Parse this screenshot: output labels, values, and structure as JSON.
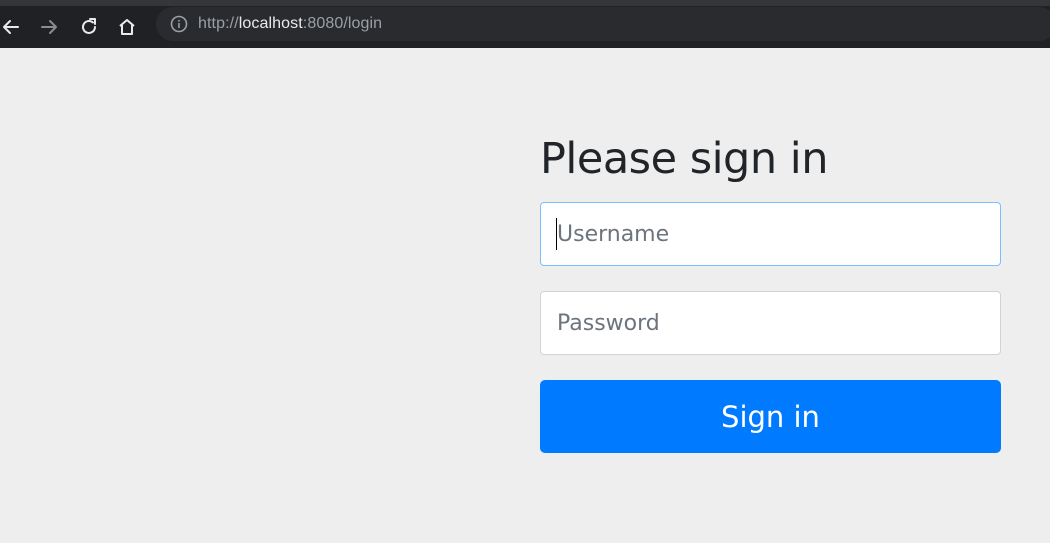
{
  "browser": {
    "url_prefix": "http://",
    "url_host": "localhost",
    "url_rest": ":8080/login",
    "icons": {
      "back": "arrow-left-icon",
      "forward": "arrow-right-icon",
      "reload": "reload-icon",
      "home": "home-icon",
      "info": "info-icon"
    }
  },
  "login": {
    "title": "Please sign in",
    "username_placeholder": "Username",
    "username_value": "",
    "password_placeholder": "Password",
    "password_value": "",
    "submit_label": "Sign in"
  },
  "colors": {
    "accent": "#007bff",
    "page_background": "#eeeeee",
    "browser_chrome": "#202124"
  }
}
